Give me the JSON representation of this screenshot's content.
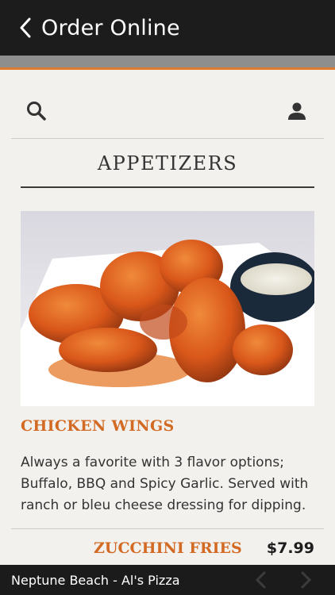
{
  "header": {
    "title": "Order Online",
    "back_icon": "chevron-left-icon"
  },
  "toolbar": {
    "search_icon": "search-icon",
    "account_icon": "user-icon"
  },
  "section": {
    "title": "APPETIZERS"
  },
  "item": {
    "name": "CHICKEN WINGS",
    "description": "Always a favorite with 3 flavor options; Buffalo, BBQ and Spicy Garlic. Served with ranch or bleu cheese dressing for dipping."
  },
  "next_item": {
    "name": "ZUCCHINI FRIES",
    "price": "$7.99"
  },
  "footer": {
    "location": "Neptune Beach - Al's Pizza"
  },
  "colors": {
    "accent": "#d26a24",
    "header_bg": "#1c1c1c",
    "band": "#8e8e8e",
    "accent_line": "#e07a2f"
  }
}
